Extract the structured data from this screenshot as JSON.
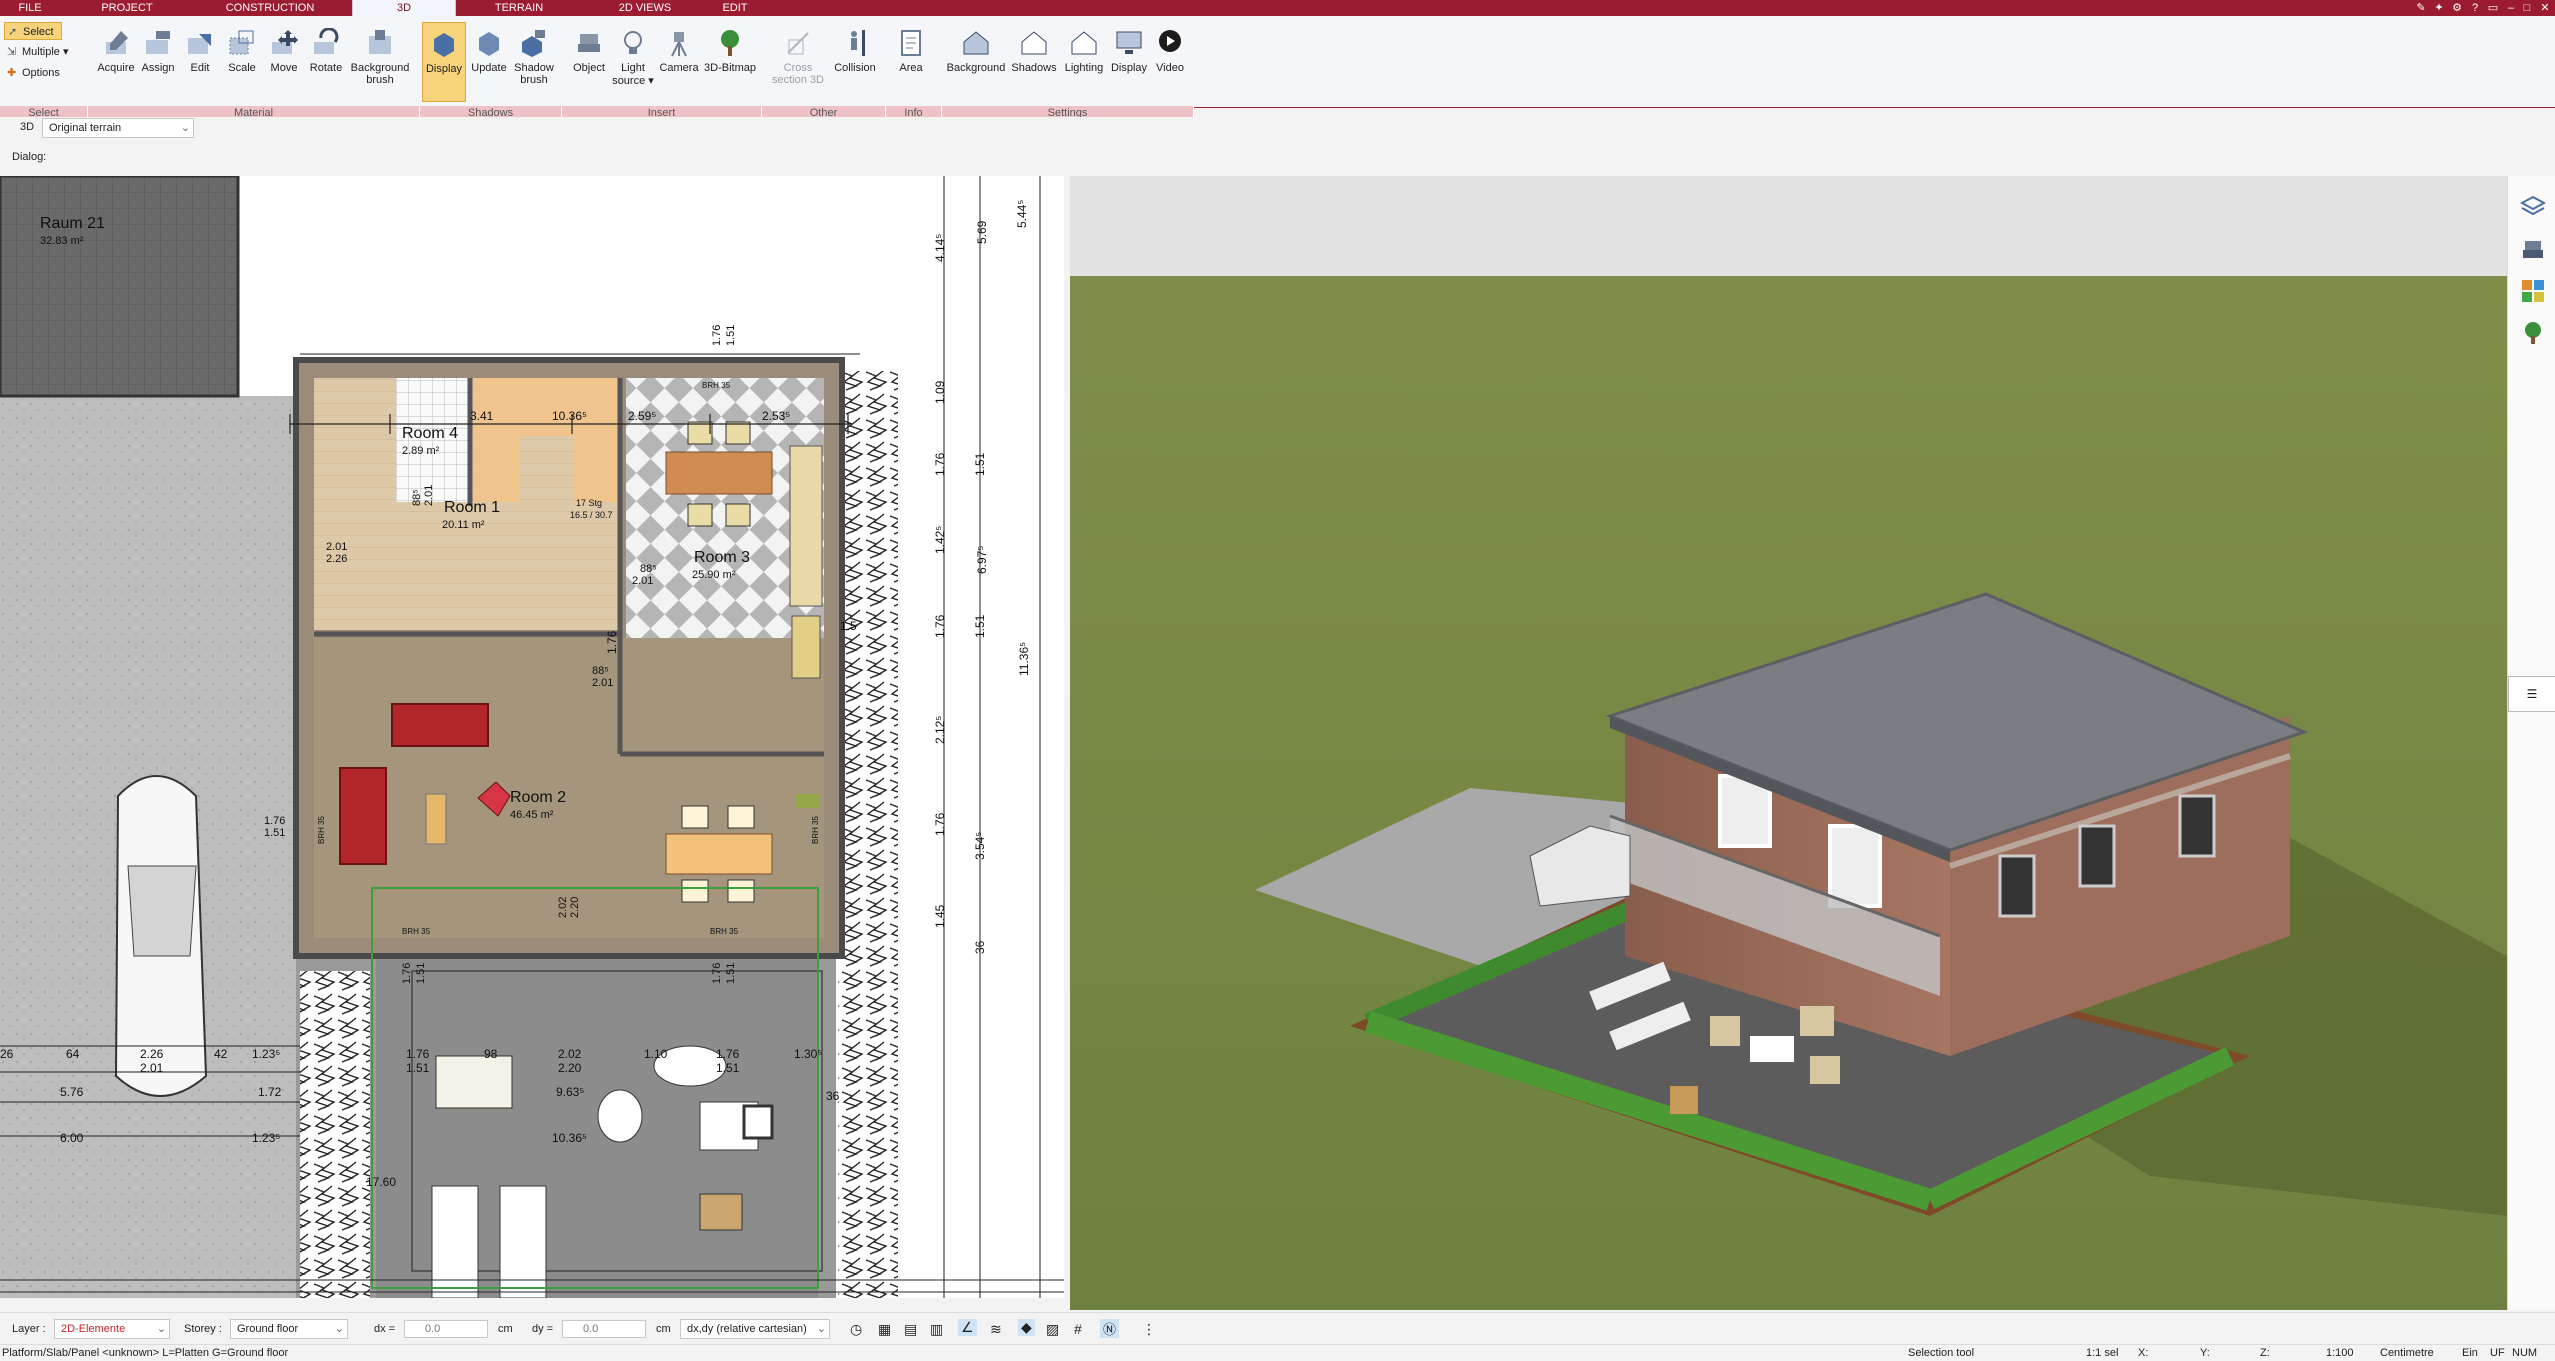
{
  "menu": {
    "file": "FILE",
    "project": "PROJECT",
    "construction": "CONSTRUCTION",
    "threed": "3D",
    "terrain": "TERRAIN",
    "views2d": "2D VIEWS",
    "edit": "EDIT"
  },
  "ribbon": {
    "select": {
      "select": "Select",
      "multiple": "Multiple",
      "options": "Options",
      "group": "Select"
    },
    "material": {
      "acquire": "Acquire",
      "assign": "Assign",
      "edit": "Edit",
      "scale": "Scale",
      "move": "Move",
      "rotate": "Rotate",
      "background_brush_1": "Background",
      "background_brush_2": "brush",
      "group": "Material"
    },
    "shadows": {
      "display": "Display",
      "update": "Update",
      "shadow_brush_1": "Shadow",
      "shadow_brush_2": "brush",
      "group": "Shadows"
    },
    "insert": {
      "object": "Object",
      "light_1": "Light",
      "light_2": "source",
      "camera": "Camera",
      "bitmap": "3D-Bitmap",
      "group": "Insert"
    },
    "other": {
      "cross_1": "Cross",
      "cross_2": "section 3D",
      "collision": "Collision",
      "group": "Other"
    },
    "info": {
      "area": "Area",
      "group": "Info"
    },
    "settings": {
      "background": "Background",
      "shadows": "Shadows",
      "lighting": "Lighting",
      "display": "Display",
      "video": "Video",
      "group": "Settings"
    }
  },
  "toolbar3d": {
    "label": "3D",
    "terrain_value": "Original terrain"
  },
  "dialog": {
    "label": "Dialog:"
  },
  "plan": {
    "rooms": [
      {
        "name": "Raum 21",
        "area": "32.83 m²"
      },
      {
        "name": "Room 4",
        "area": "2.89 m²"
      },
      {
        "name": "Room 1",
        "area": "20.11 m²"
      },
      {
        "name": "Room 3",
        "area": "25.90 m²"
      },
      {
        "name": "Room 2",
        "area": "46.45 m²"
      }
    ],
    "dims_top": [
      "3.41",
      "10.36⁵",
      "2.59⁵",
      "2.53⁵"
    ],
    "dims_right": [
      "5.69",
      "5.44⁵",
      "4.14⁵",
      "1.09",
      "1.76",
      "1.51",
      "1.42⁵",
      "6.97⁵",
      "11.36⁵",
      "1.76",
      "1.51",
      "2.12⁵",
      "1.76",
      "1.51",
      "3.54⁵",
      "1.45",
      "36"
    ],
    "dims_bottom": [
      "64",
      "2.26",
      "2.01",
      "42",
      "1.23⁵",
      "5.76",
      "1.72",
      "6.00",
      "1.23⁵",
      "1.76",
      "1.51",
      "98",
      "2.02",
      "2.20",
      "1.10",
      "1.76",
      "1.51",
      "1.30⁵",
      "9.63⁵",
      "10.36⁵",
      "17.60",
      "36"
    ],
    "misc": [
      "2.01",
      "2.26",
      "88⁵",
      "2.01",
      "88⁵",
      "2.01",
      "1.76",
      "1.51",
      "BRH 35",
      "BRH 35",
      "BRH 35",
      "BRH 35",
      "BRH 35",
      "BRH 35",
      "17 Stg",
      "16.5 / 30.7",
      "2.02",
      "2.20",
      "1.76",
      "1.51",
      "1.76",
      "1.51",
      "1.76",
      "1.51",
      "1.76"
    ]
  },
  "bottombar": {
    "layer_label": "Layer :",
    "layer_value": "2D-Elemente",
    "storey_label": "Storey :",
    "storey_value": "Ground floor",
    "dx_label": "dx =",
    "dx_value": "0.0",
    "dx_unit": "cm",
    "dy_label": "dy =",
    "dy_value": "0.0",
    "dy_unit": "cm",
    "mode_value": "dx,dy (relative cartesian)"
  },
  "status": {
    "left": "Platform/Slab/Panel <unknown> L=Platten G=Ground floor",
    "tool": "Selection tool",
    "sel": "1:1 sel",
    "x": "X:",
    "y": "Y:",
    "z": "Z:",
    "scale": "1:100",
    "unit": "Centimetre",
    "ein": "Ein",
    "uf": "UF",
    "num": "NUM"
  },
  "colors": {
    "brand": "#9b1b30",
    "ribbon_group": "#efc3c6",
    "active": "#f7d37c",
    "grass": "#7f8f4a"
  }
}
